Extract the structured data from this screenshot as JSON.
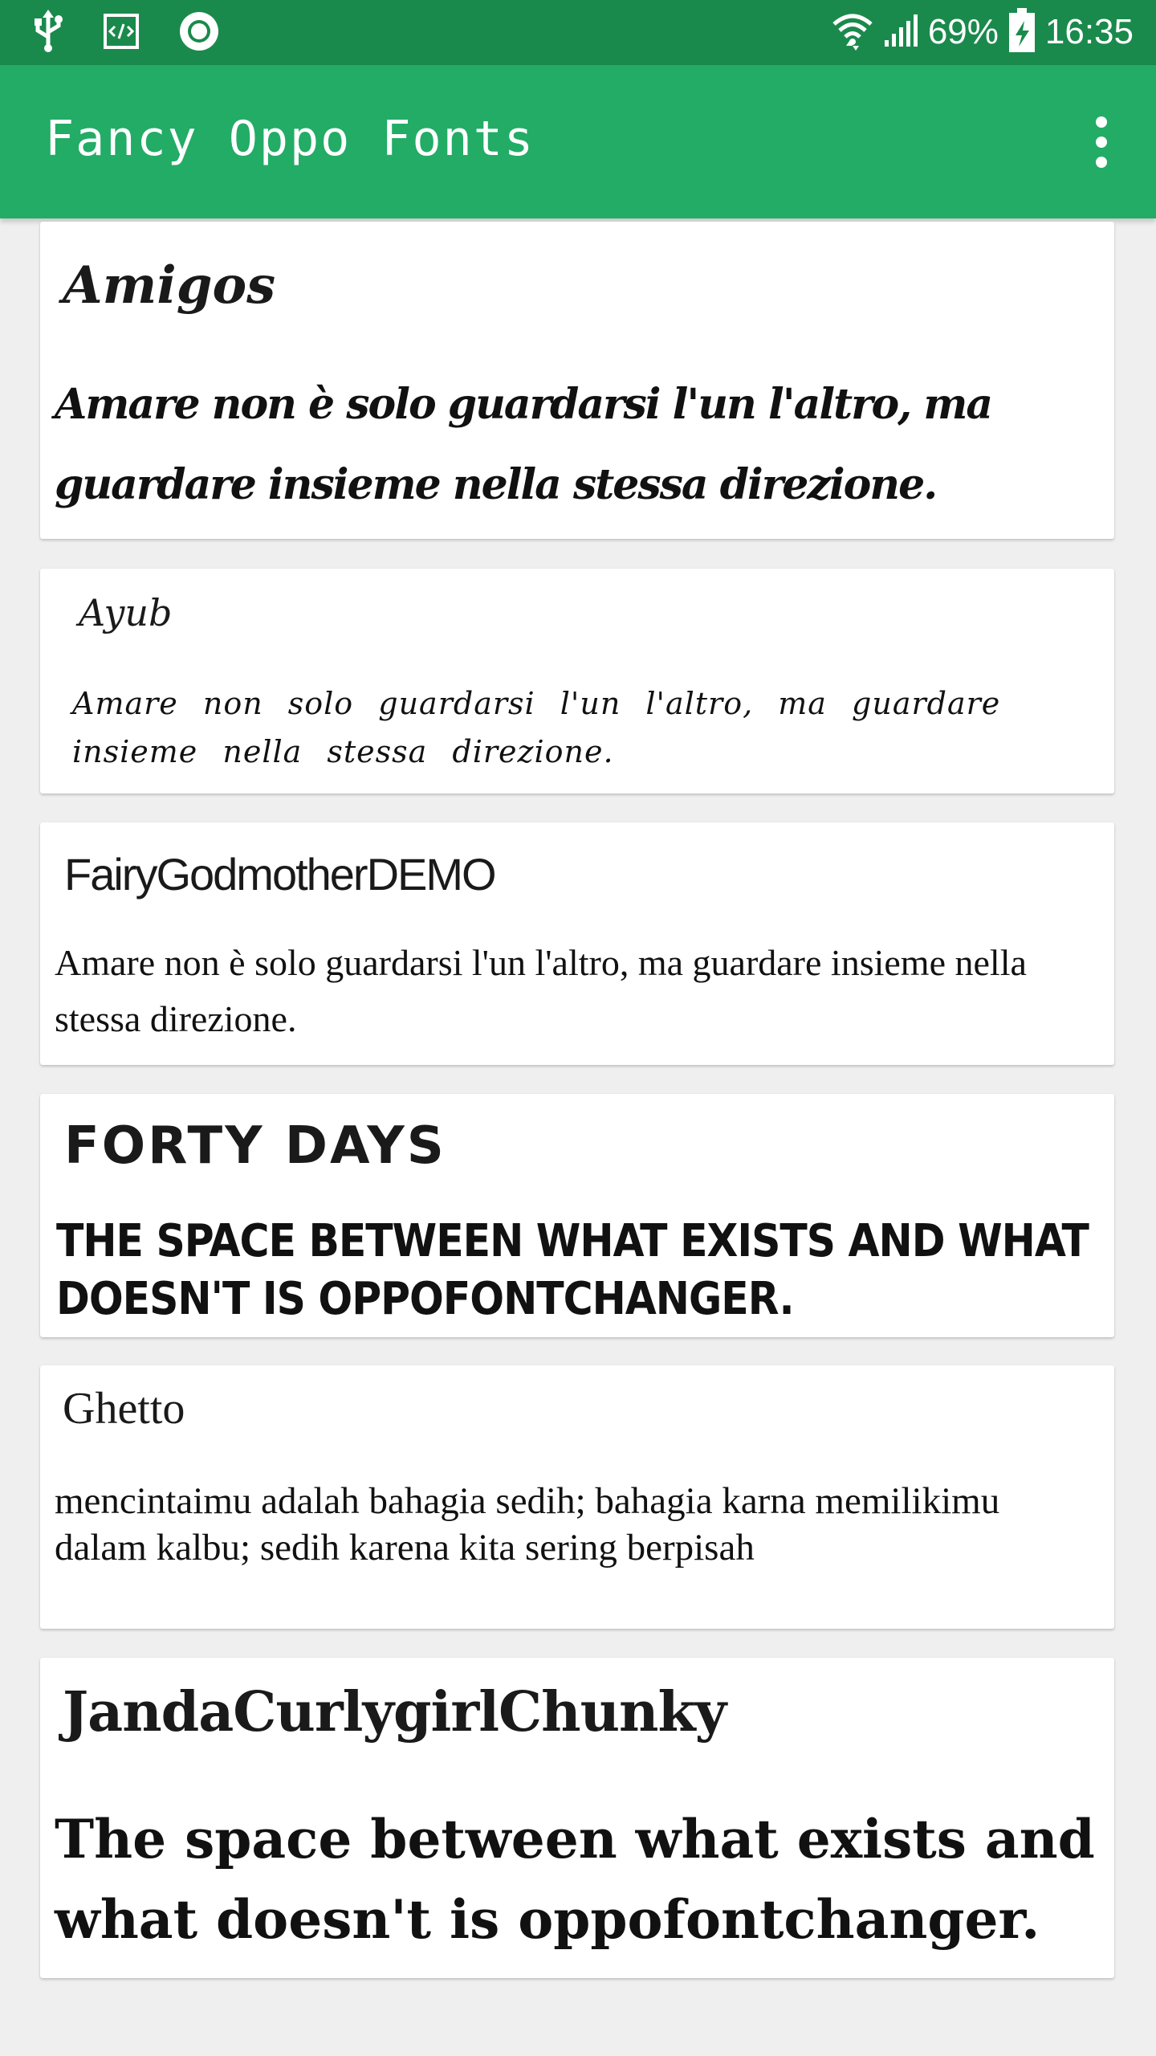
{
  "status_bar": {
    "battery_percent": "69%",
    "time": "16:35",
    "left_icons": [
      "usb-icon",
      "developer-mode-icon",
      "record-icon"
    ],
    "right_icons": [
      "wifi-icon",
      "signal-icon",
      "battery-charging-icon"
    ]
  },
  "app_bar": {
    "title": "Fancy Oppo Fonts",
    "menu_icon": "more-vert-icon",
    "background_color": "#22ac66",
    "status_color": "#1a8a4c"
  },
  "fonts": [
    {
      "name": "Amigos",
      "sample": "Amare non è solo guardarsi l'un l'altro, ma guardare insieme nella stessa direzione."
    },
    {
      "name": "Ayub",
      "sample": "Amare non solo guardarsi l'un l'altro, ma guardare insieme nella stessa direzione."
    },
    {
      "name": "FairyGodmotherDEMO",
      "sample": "Amare non è solo guardarsi l'un l'altro, ma guardare insieme nella stessa direzione."
    },
    {
      "name": "FORTY DAYS",
      "sample": "THE SPACE BETWEEN WHAT EXISTS AND WHAT DOESN'T IS OPPOFONTCHANGER."
    },
    {
      "name": "Ghetto",
      "sample": "mencintaimu adalah bahagia sedih; bahagia karna memilikimu dalam kalbu; sedih karena kita sering berpisah"
    },
    {
      "name": "JandaCurlygirlChunky",
      "sample": "The space between what exists and what doesn't is oppofontchanger."
    }
  ]
}
